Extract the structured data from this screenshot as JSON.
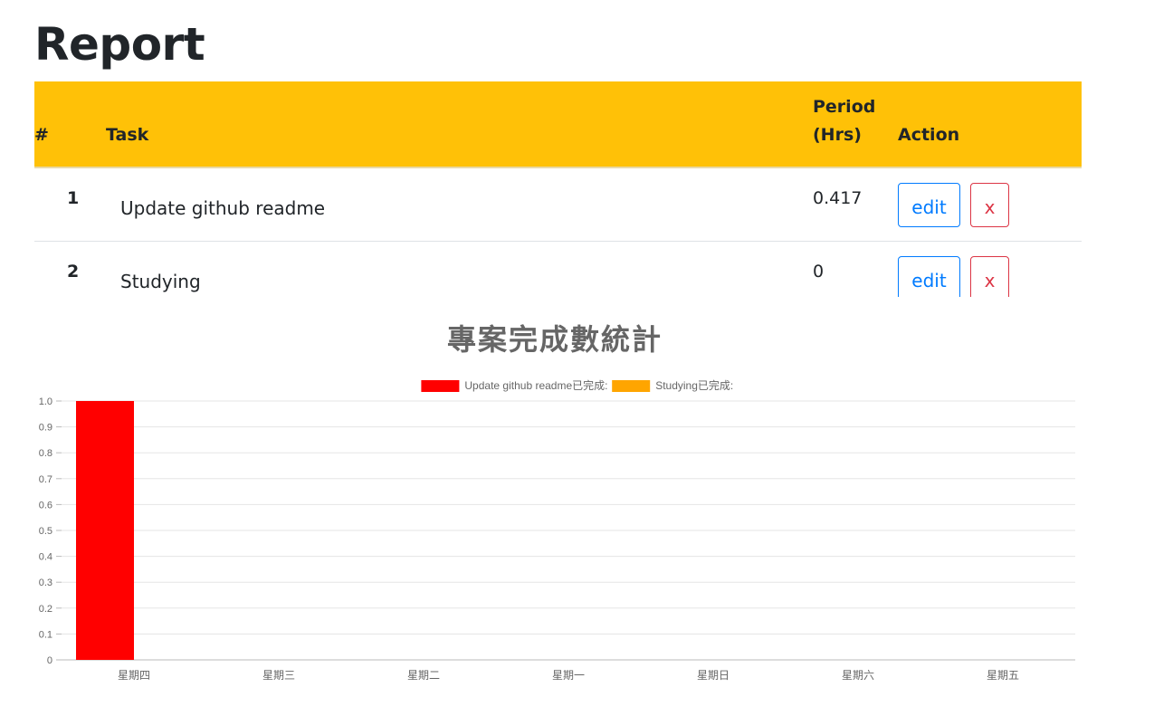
{
  "page": {
    "title": "Report"
  },
  "table": {
    "headers": {
      "num": "#",
      "task": "Task",
      "period_line1": "Period",
      "period_line2": "(Hrs)",
      "action": "Action"
    },
    "rows": [
      {
        "num": "1",
        "task": "Update github readme",
        "period": "0.417",
        "edit_label": "edit",
        "delete_label": "x"
      },
      {
        "num": "2",
        "task": "Studying",
        "period": "0",
        "edit_label": "edit",
        "delete_label": "x"
      }
    ]
  },
  "colors": {
    "header_bg": "#ffc107",
    "edit_button": "#007bff",
    "delete_button": "#dc3545",
    "series_1": "#ff0000",
    "series_2": "#ffa500"
  },
  "chart_data": {
    "type": "bar",
    "title": "專案完成數統計",
    "categories": [
      "星期四",
      "星期三",
      "星期二",
      "星期一",
      "星期日",
      "星期六",
      "星期五"
    ],
    "series": [
      {
        "name": "Update github readme已完成:",
        "color": "#ff0000",
        "values": [
          1,
          0,
          0,
          0,
          0,
          0,
          0
        ]
      },
      {
        "name": "Studying已完成:",
        "color": "#ffa500",
        "values": [
          0,
          0,
          0,
          0,
          0,
          0,
          0
        ]
      }
    ],
    "ylim": [
      0,
      1.0
    ],
    "yticks": [
      "0",
      "0.1",
      "0.2",
      "0.3",
      "0.4",
      "0.5",
      "0.6",
      "0.7",
      "0.8",
      "0.9",
      "1.0"
    ],
    "grid": true,
    "legend": "top-center"
  }
}
